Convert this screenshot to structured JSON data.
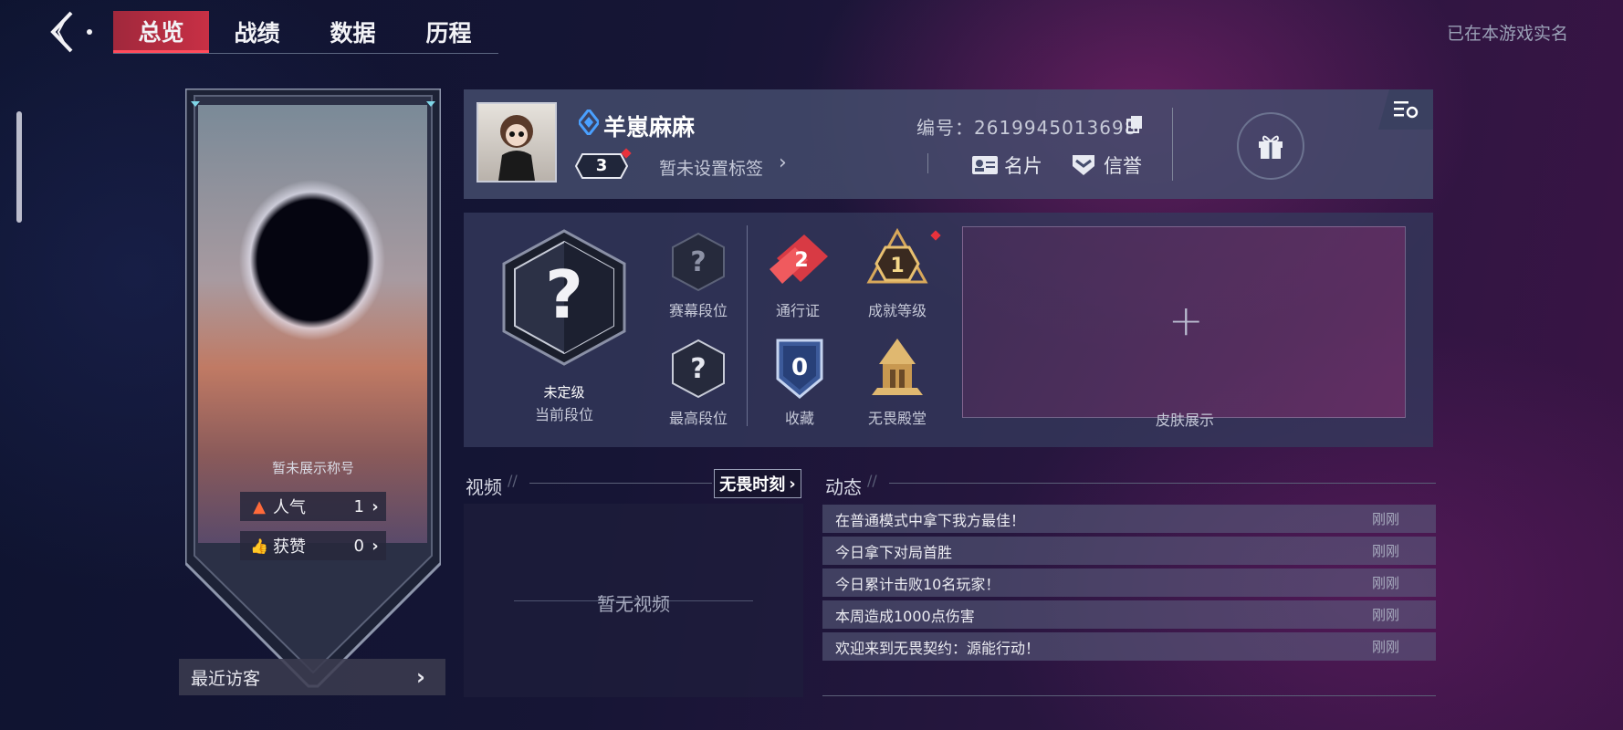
{
  "nav": {
    "tabs": [
      "总览",
      "战绩",
      "数据",
      "历程"
    ],
    "active_tab": 0,
    "realname_status": "已在本游戏实名"
  },
  "card": {
    "title": "暂未展示称号",
    "popularity": {
      "label": "人气",
      "value": "1"
    },
    "likes": {
      "label": "获赞",
      "value": "0"
    },
    "recent_visitors": "最近访客"
  },
  "profile": {
    "username": "羊崽麻麻",
    "level": "3",
    "tag": "暂未设置标签",
    "id_text": "编号：2619945013698",
    "card_btn": "名片",
    "credit_btn": "信誉"
  },
  "rank": {
    "current_rank": "未定级",
    "current_rank_label": "当前段位",
    "season_rank_label": "赛幕段位",
    "highest_rank_label": "最高段位",
    "pass_label": "通行证",
    "pass_value": "2",
    "achievement_label": "成就等级",
    "achievement_value": "1",
    "collection_label": "收藏",
    "collection_value": "0",
    "hall_label": "无畏殿堂",
    "skin_label": "皮肤展示"
  },
  "video": {
    "title": "视频",
    "link": "无畏时刻",
    "empty": "暂无视频"
  },
  "feed": {
    "title": "动态",
    "items": [
      {
        "text": "在普通模式中拿下我方最佳！",
        "time": "刚刚"
      },
      {
        "text": "今日拿下对局首胜",
        "time": "刚刚"
      },
      {
        "text": "今日累计击败10名玩家！",
        "time": "刚刚"
      },
      {
        "text": "本周造成1000点伤害",
        "time": "刚刚"
      },
      {
        "text": "欢迎来到无畏契约：源能行动！",
        "time": "刚刚"
      }
    ]
  },
  "colors": {
    "accent_red": "#c83045",
    "pass_red": "#e0404a",
    "gold": "#d8a85a",
    "diamond_blue": "#4aa0ff"
  }
}
